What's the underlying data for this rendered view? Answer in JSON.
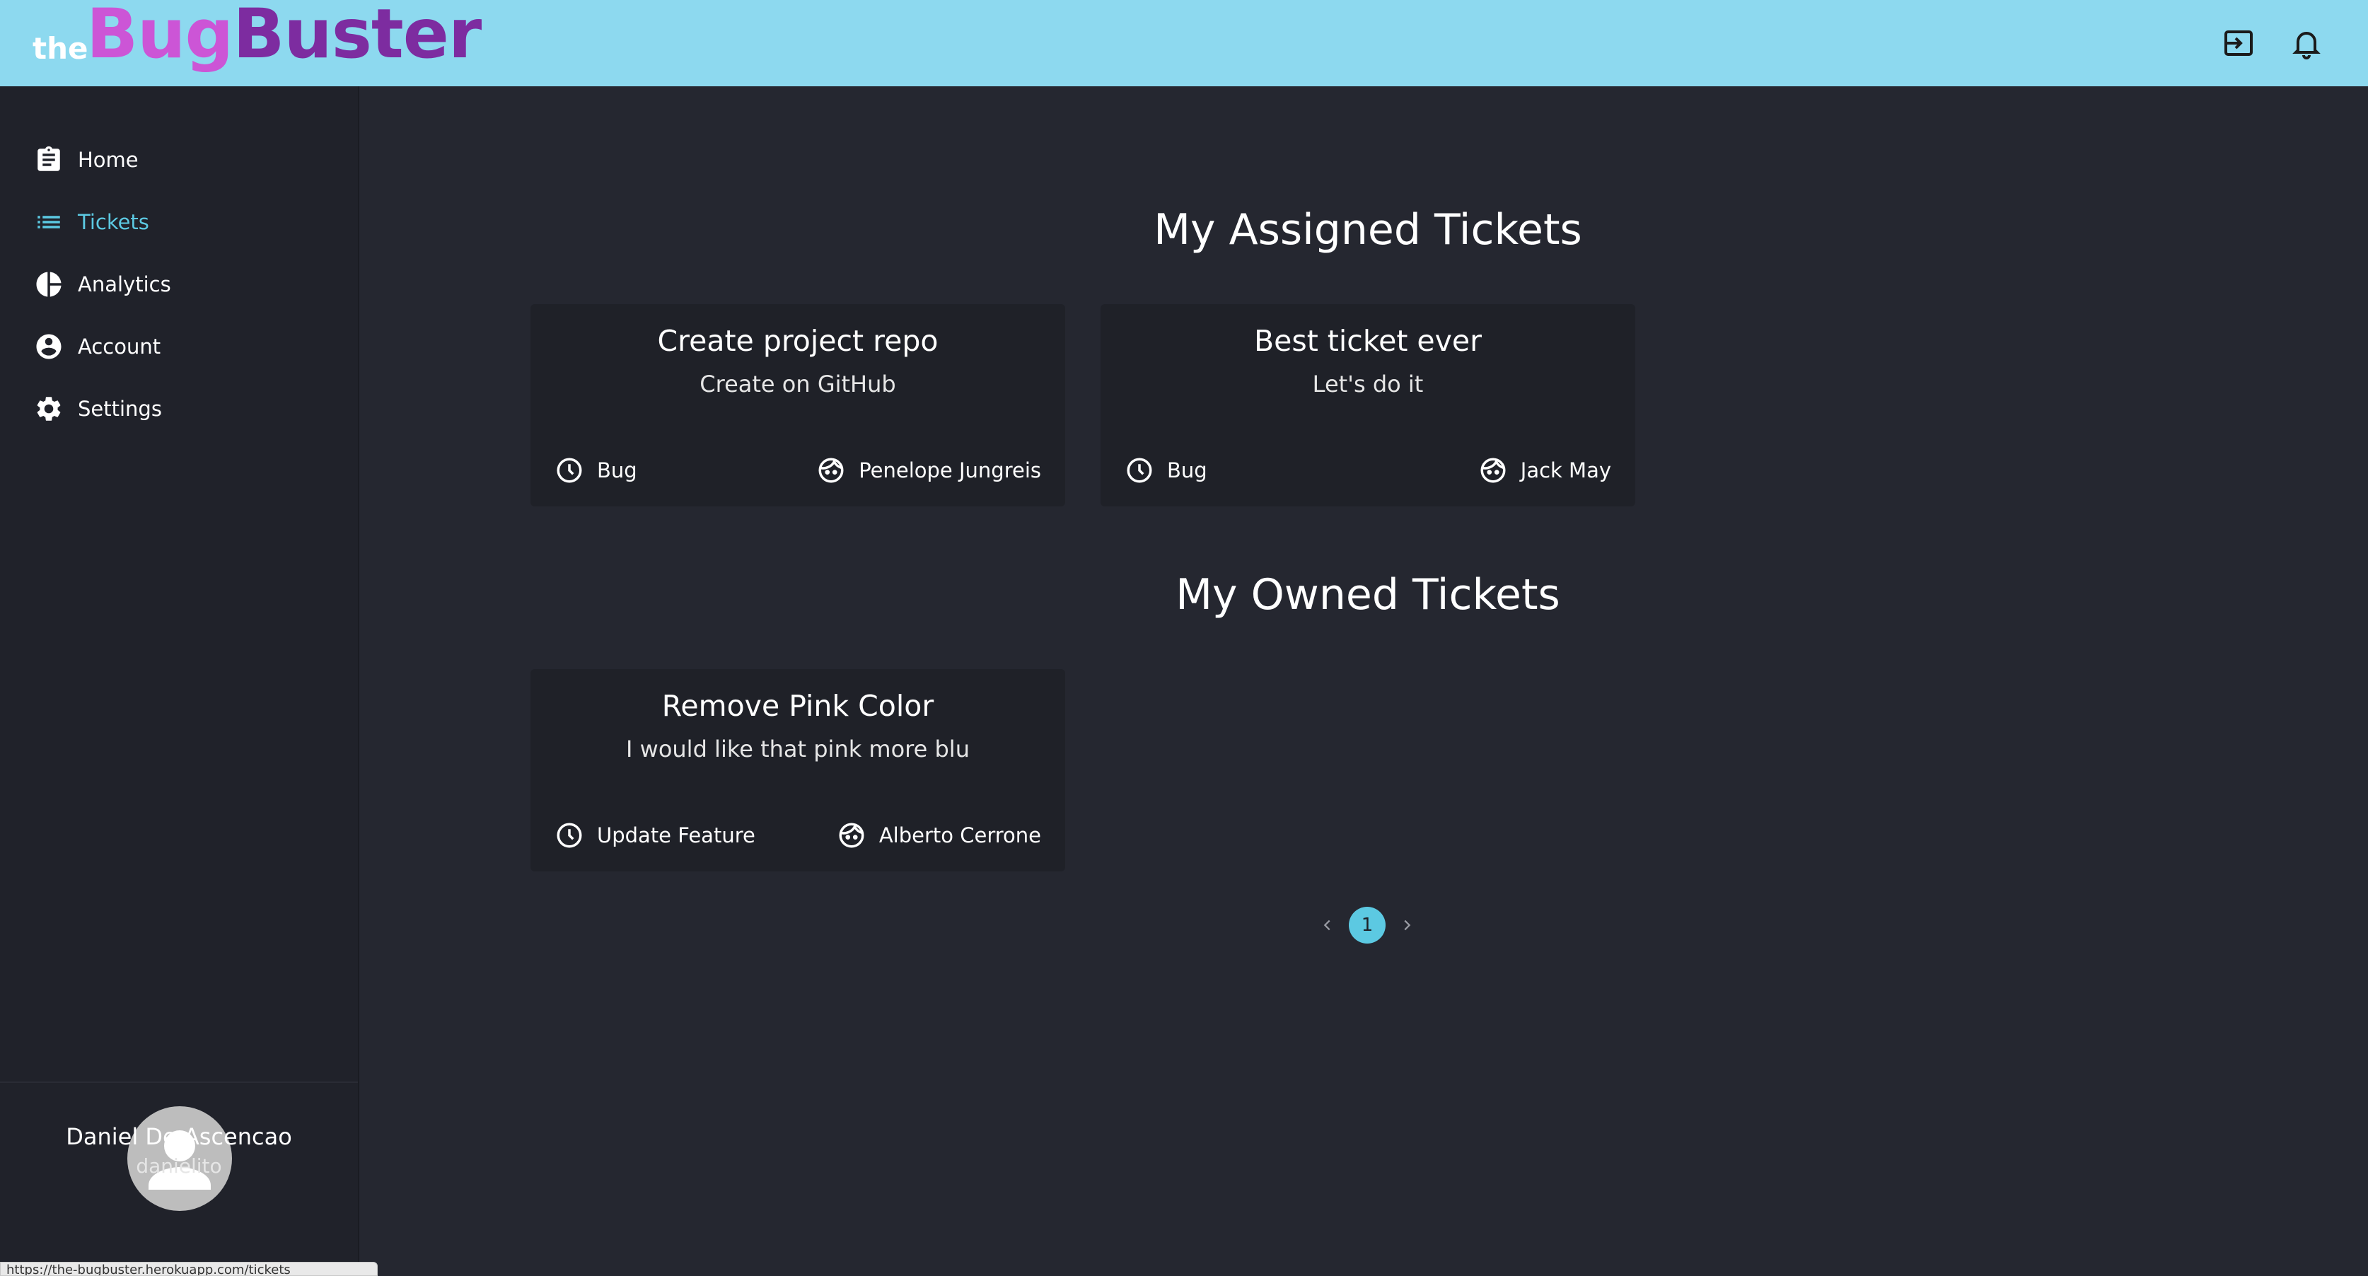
{
  "app": {
    "logo_prefix": "the",
    "logo_part1": "Bug",
    "logo_part2": "Buster"
  },
  "topbar": {
    "icons": [
      "logout-icon",
      "bell-icon"
    ]
  },
  "sidebar": {
    "items": [
      {
        "label": "Home",
        "icon": "clipboard-icon",
        "active": false
      },
      {
        "label": "Tickets",
        "icon": "list-icon",
        "active": true
      },
      {
        "label": "Analytics",
        "icon": "pie-chart-icon",
        "active": false
      },
      {
        "label": "Account",
        "icon": "account-circle-icon",
        "active": false
      },
      {
        "label": "Settings",
        "icon": "gear-icon",
        "active": false
      }
    ],
    "user": {
      "name": "Daniel De Ascencao",
      "handle": "danielito"
    }
  },
  "status_bar": {
    "url": "https://the-bugbuster.herokuapp.com/tickets"
  },
  "main": {
    "assigned": {
      "title": "My Assigned Tickets",
      "tickets": [
        {
          "title": "Create project repo",
          "description": "Create on GitHub",
          "type": "Bug",
          "person": "Penelope Jungreis"
        },
        {
          "title": "Best ticket ever",
          "description": "Let's do it",
          "type": "Bug",
          "person": "Jack May"
        }
      ]
    },
    "owned": {
      "title": "My Owned Tickets",
      "tickets": [
        {
          "title": "Remove Pink Color",
          "description": "I would like that pink more blu",
          "type": "Update Feature",
          "person": "Alberto Cerrone"
        }
      ]
    },
    "pagination": {
      "current_page": "1"
    }
  },
  "colors": {
    "topbar": "#8dd9ef",
    "background": "#252730",
    "sidebar": "#20222a",
    "card": "#1f2128",
    "accent": "#5cc9e2",
    "logo_pink": "#cc55d6",
    "logo_purple": "#7d2ca0"
  }
}
